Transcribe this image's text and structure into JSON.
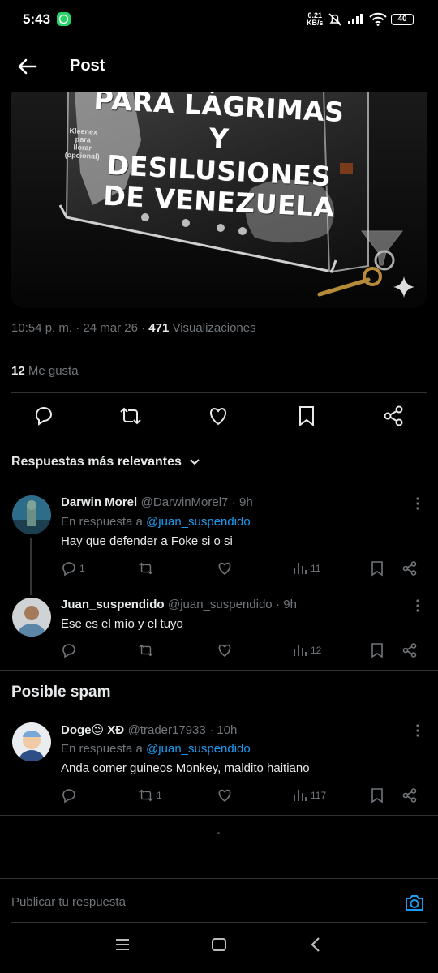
{
  "status_bar": {
    "time": "5:43",
    "net_speed": "0.21",
    "net_unit": "KB/s",
    "battery": "40"
  },
  "header": {
    "title": "Post"
  },
  "media": {
    "lines": [
      "PARA LÁGRIMAS",
      "Y",
      "DESILUSIONES",
      "DE VENEZUELA"
    ],
    "kleenex_note": [
      "Kleenex",
      "para",
      "llorar",
      "(opcional)"
    ]
  },
  "post_meta": {
    "time": "10:54 p. m.",
    "date": "24 mar 26",
    "views_count": "471",
    "views_label": "Visualizaciones",
    "likes_count": "12",
    "likes_label": "Me gusta"
  },
  "sort_label": "Respuestas más relevantes",
  "replies": [
    {
      "name": "Darwin Morel",
      "handle": "@DarwinMorel7",
      "time": "· 9h",
      "replying_prefix": "En respuesta a",
      "replying_to": "@juan_suspendido",
      "text": "Hay que defender a Foke si o si",
      "reply_count": "1",
      "repost_count": "",
      "views": "11"
    },
    {
      "name": "Juan_suspendido",
      "handle": "@juan_suspendido",
      "time": "· 9h",
      "text": "Ese es el mío y el tuyo",
      "reply_count": "",
      "repost_count": "",
      "views": "12"
    }
  ],
  "spam_section": {
    "title": "Posible spam",
    "reply": {
      "name": "Doge😉 XĐ",
      "handle": "@trader17933",
      "time": "· 10h",
      "replying_prefix": "En respuesta a",
      "replying_to": "@juan_suspendido",
      "text": "Anda comer guineos Monkey, maldito haitiano",
      "reply_count": "",
      "repost_count": "1",
      "views": "117"
    }
  },
  "composer": {
    "placeholder": "Publicar tu respuesta"
  },
  "colors": {
    "accent": "#1d9bf0",
    "muted": "#71767b",
    "divider": "#2f3336"
  }
}
